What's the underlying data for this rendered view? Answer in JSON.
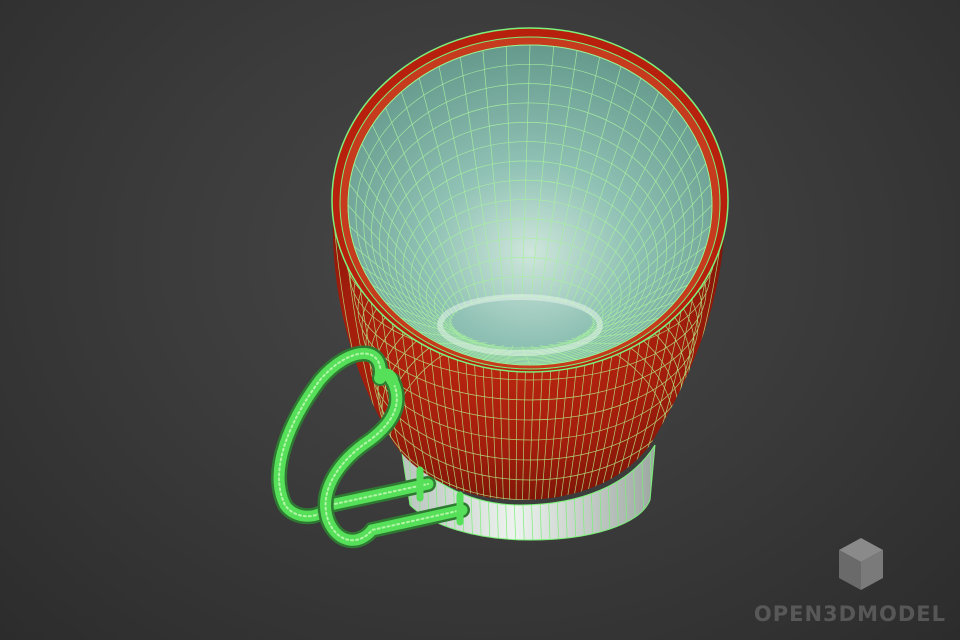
{
  "scene": {
    "subject": "cup-wireframe",
    "colors": {
      "background": "#3a3a3a",
      "cup_body": "#a31d0c",
      "cup_interior": "#7bb0a4",
      "wire": "#7cf07a",
      "handle": "#56e05a",
      "base": "#d8e0da"
    }
  },
  "watermark": {
    "text": "OPEN3DMODEL",
    "logo": "cube-logo-icon"
  }
}
